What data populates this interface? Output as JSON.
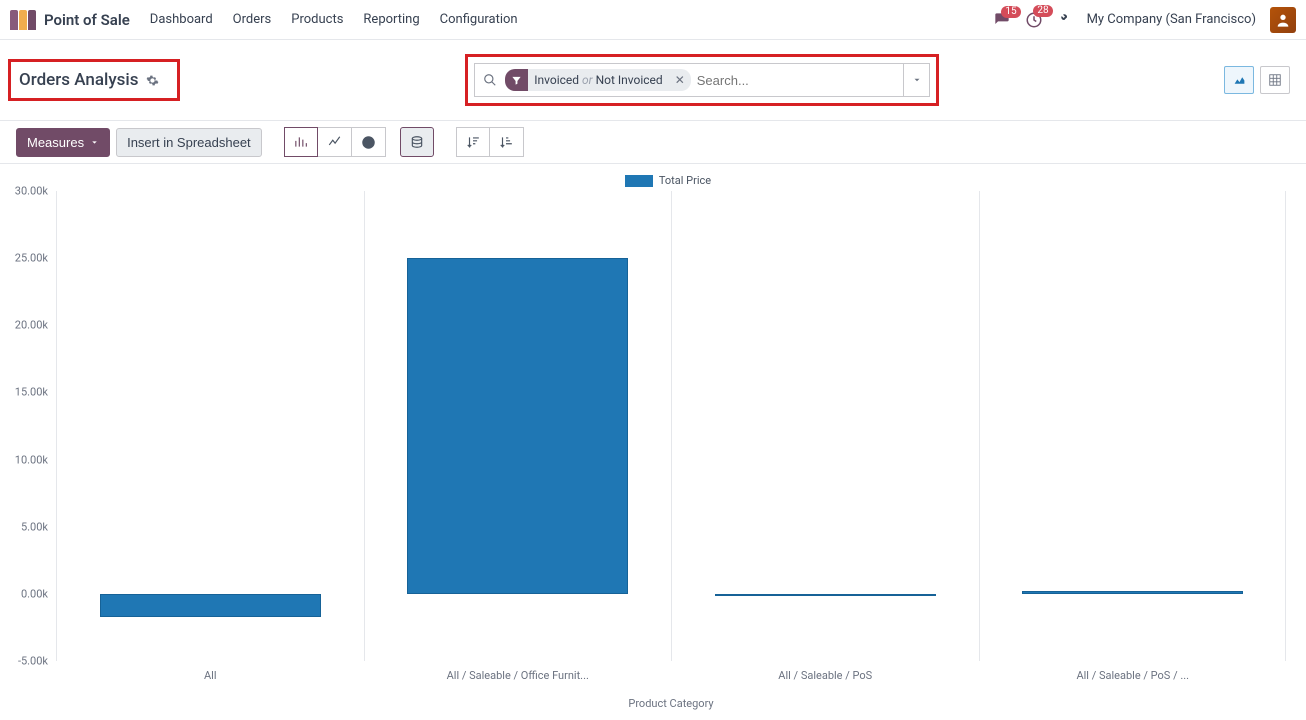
{
  "nav": {
    "app": "Point of Sale",
    "links": [
      "Dashboard",
      "Orders",
      "Products",
      "Reporting",
      "Configuration"
    ],
    "messages_badge": "15",
    "activities_badge": "28",
    "company": "My Company (San Francisco)"
  },
  "header": {
    "title": "Orders Analysis",
    "filter_chip_a": "Invoiced",
    "filter_chip_or": "or",
    "filter_chip_b": "Not Invoiced",
    "search_placeholder": "Search..."
  },
  "toolbar": {
    "measures": "Measures",
    "insert": "Insert in Spreadsheet"
  },
  "chart_data": {
    "type": "bar",
    "title": "",
    "legend": "Total Price",
    "xlabel": "Product Category",
    "ylabel": "",
    "ylim": [
      -5000,
      30000
    ],
    "yticks": [
      "-5.00k",
      "0.00k",
      "5.00k",
      "10.00k",
      "15.00k",
      "20.00k",
      "25.00k",
      "30.00k"
    ],
    "ytick_vals": [
      -5000,
      0,
      5000,
      10000,
      15000,
      20000,
      25000,
      30000
    ],
    "categories": [
      "All",
      "All / Saleable / Office Furnit...",
      "All / Saleable / PoS",
      "All / Saleable / PoS / ..."
    ],
    "values": [
      -1750,
      25000,
      0,
      200
    ]
  }
}
